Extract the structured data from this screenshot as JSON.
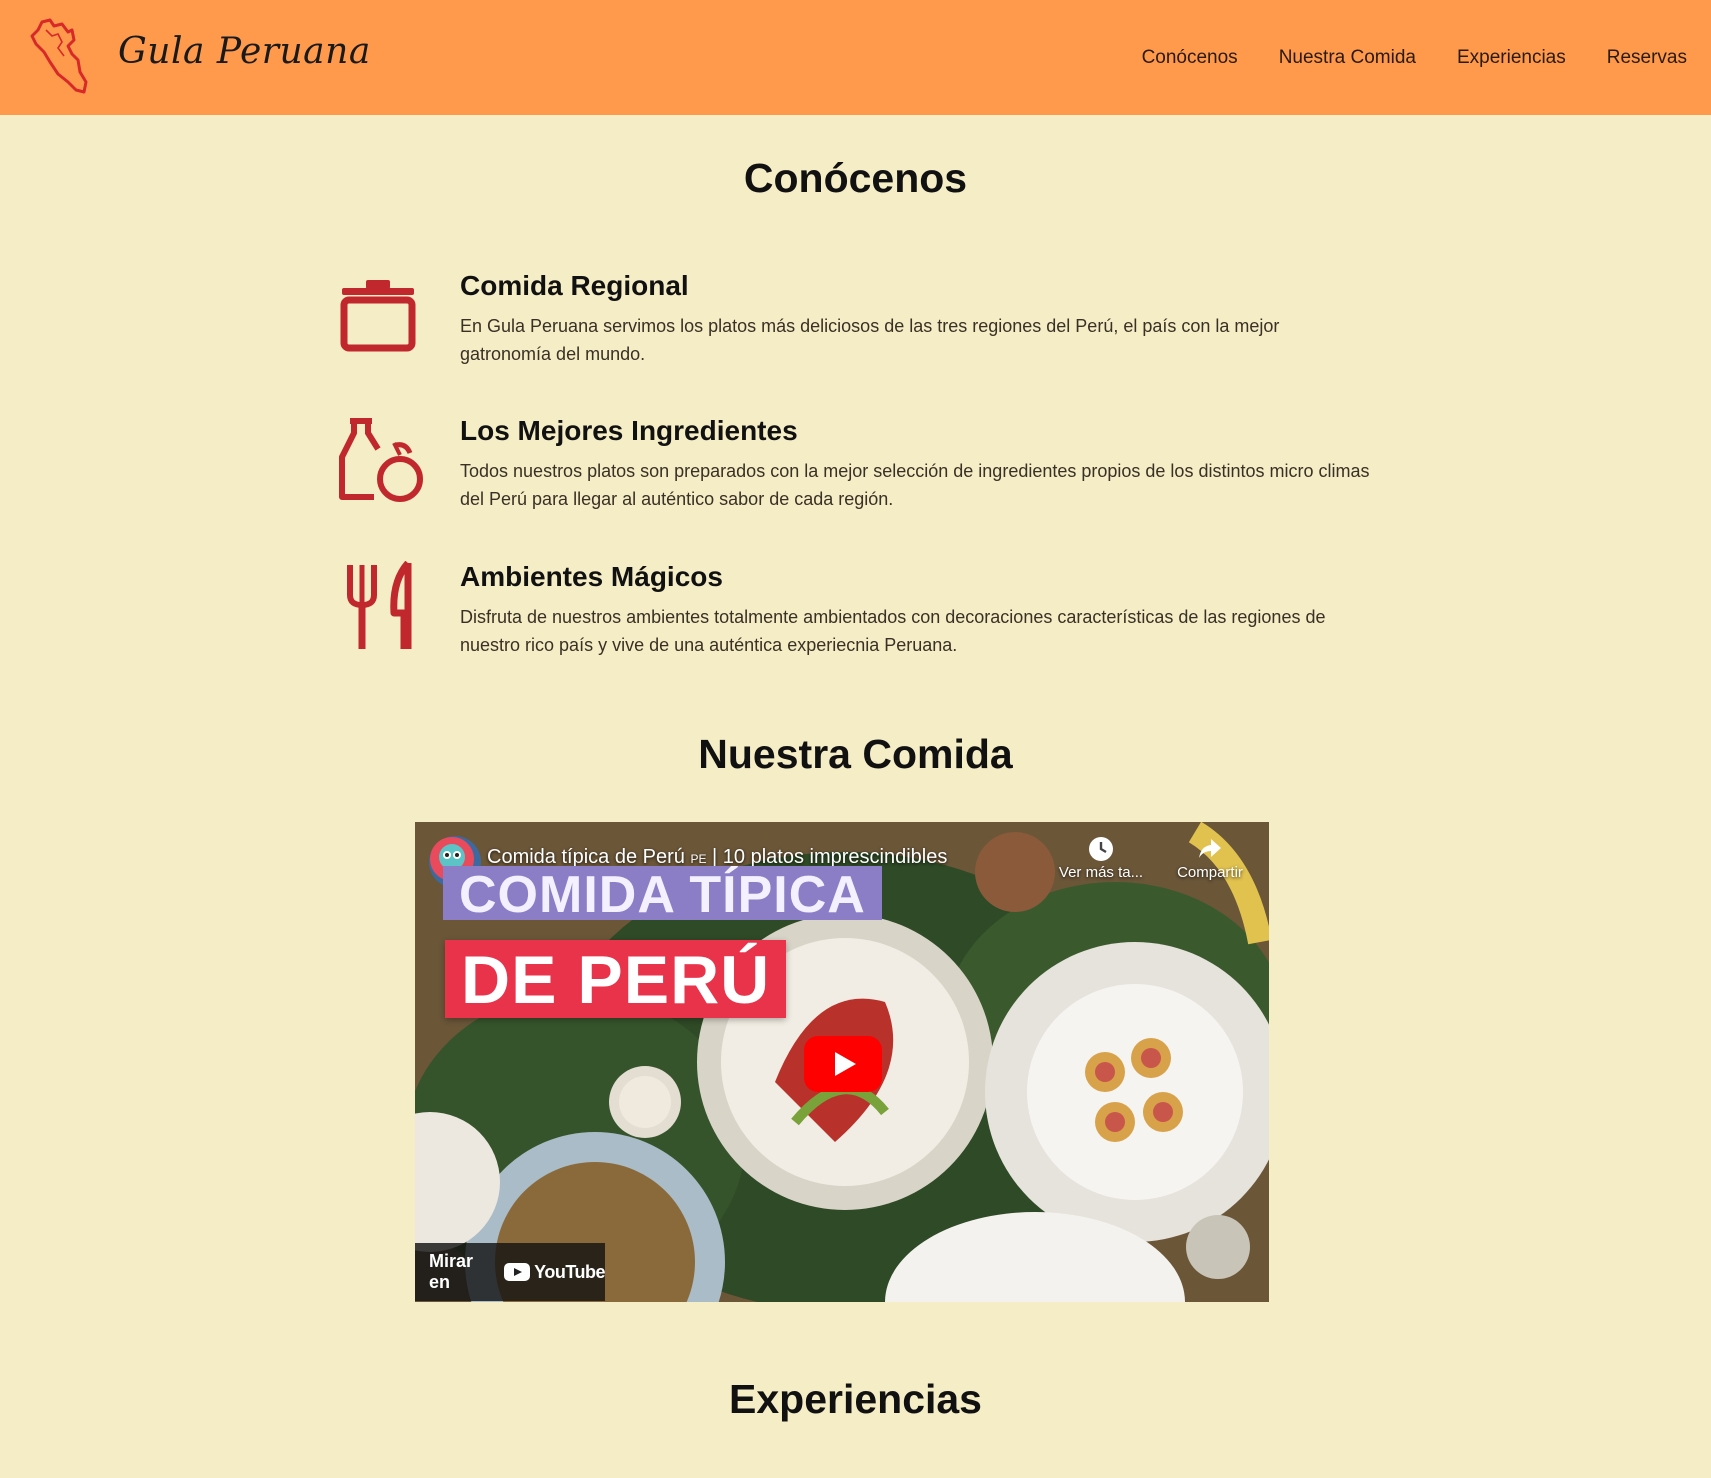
{
  "header": {
    "brand": "Gula Peruana",
    "logo_icon": "peru-map-icon",
    "nav": [
      "Conócenos",
      "Nuestra Comida",
      "Experiencias",
      "Reservas"
    ]
  },
  "sections": {
    "about_title": "Conócenos",
    "food_title": "Nuestra Comida",
    "experiences_title": "Experiencias"
  },
  "features": [
    {
      "icon": "pot-icon",
      "title": "Comida Regional",
      "text": "En Gula Peruana servimos los platos más deliciosos de las tres regiones del Perú, el país con la mejor gatronomía del mundo."
    },
    {
      "icon": "bottle-apple-icon",
      "title": "Los Mejores Ingredientes",
      "text": "Todos nuestros platos son preparados con la mejor selección de ingredientes propios de los distintos micro climas del Perú para llegar al auténtico sabor de cada región."
    },
    {
      "icon": "fork-knife-icon",
      "title": "Ambientes Mágicos",
      "text": "Disfruta de nuestros ambientes totalmente ambientados con decoraciones características de las regiones de nuestro rico país y vive de una auténtica experiecnia Peruana."
    }
  ],
  "video": {
    "title": "Comida típica de Perú",
    "title_flag": "PE",
    "title_rest": " | 10 platos imprescindibles",
    "watch_later": "Ver más ta...",
    "share": "Compartir",
    "banner_line1": "COMIDA TÍPICA",
    "banner_line2": "DE PERÚ",
    "watch_on": "Mirar en",
    "youtube": "YouTube"
  },
  "colors": {
    "header_bg": "#ff9a4d",
    "page_bg": "#f4edc6",
    "icon_red": "#c0282d"
  }
}
